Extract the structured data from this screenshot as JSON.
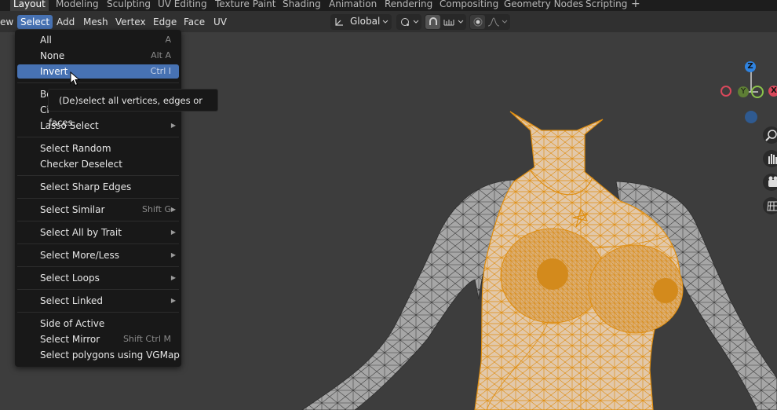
{
  "workspace_tabs": [
    "Layout",
    "Modeling",
    "Sculpting",
    "UV Editing",
    "Texture Paint",
    "Shading",
    "Animation",
    "Rendering",
    "Compositing",
    "Geometry Nodes",
    "Scripting"
  ],
  "add_workspace": "+",
  "header": {
    "view_partial": "ew",
    "menus": [
      "Select",
      "Add",
      "Mesh",
      "Vertex",
      "Edge",
      "Face",
      "UV"
    ],
    "transform_orientation": "Global"
  },
  "select_menu": {
    "items": [
      {
        "label": "All",
        "shortcut": "A"
      },
      {
        "label": "None",
        "shortcut": "Alt A"
      },
      {
        "label": "Invert",
        "shortcut": "Ctrl I"
      },
      {
        "label": "Bo",
        "shortcut": ""
      },
      {
        "label": "Ci",
        "shortcut": ""
      },
      {
        "label": "Lasso Select",
        "shortcut": ""
      },
      {
        "label": "Select Random",
        "shortcut": ""
      },
      {
        "label": "Checker Deselect",
        "shortcut": ""
      },
      {
        "label": "Select Sharp Edges",
        "shortcut": ""
      },
      {
        "label": "Select Similar",
        "shortcut": "Shift G"
      },
      {
        "label": "Select All by Trait",
        "shortcut": ""
      },
      {
        "label": "Select More/Less",
        "shortcut": ""
      },
      {
        "label": "Select Loops",
        "shortcut": ""
      },
      {
        "label": "Select Linked",
        "shortcut": ""
      },
      {
        "label": "Side of Active",
        "shortcut": ""
      },
      {
        "label": "Select Mirror",
        "shortcut": "Shift Ctrl M"
      },
      {
        "label": "Select polygons using VGMap",
        "shortcut": ""
      }
    ],
    "highlighted": "Invert"
  },
  "tooltip": "(De)select all vertices, edges or faces.",
  "gizmo": {
    "z": "Z",
    "y": "Y",
    "x": "X",
    "z_color": "#2f83e0",
    "y_color": "#8bc34a",
    "x_color": "#d9485b"
  },
  "colors": {
    "selection": "#e8a030",
    "menu_highlight": "#4772b3",
    "mesh_unselected": "#a9a9a9"
  }
}
